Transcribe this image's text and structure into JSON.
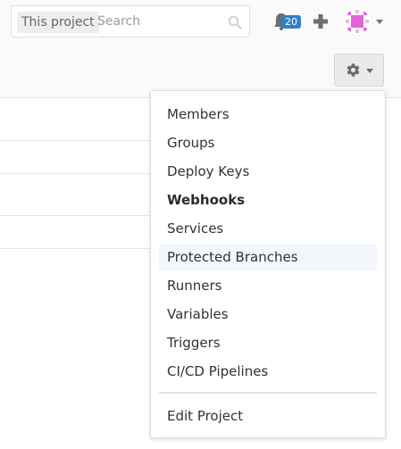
{
  "search": {
    "scope_label": "This project",
    "placeholder": "Search"
  },
  "notifications": {
    "count": "20"
  },
  "settings_menu": {
    "items": [
      {
        "label": "Members"
      },
      {
        "label": "Groups"
      },
      {
        "label": "Deploy Keys"
      },
      {
        "label": "Webhooks"
      },
      {
        "label": "Services"
      },
      {
        "label": "Protected Branches"
      },
      {
        "label": "Runners"
      },
      {
        "label": "Variables"
      },
      {
        "label": "Triggers"
      },
      {
        "label": "CI/CD Pipelines"
      }
    ],
    "footer_item": {
      "label": "Edit Project"
    },
    "active_item": "Webhooks",
    "hovered_item": "Protected Branches"
  },
  "icons": {
    "search": "search-icon",
    "notifications": "bell-icon",
    "new": "plus-icon",
    "avatar": "identicon-avatar",
    "settings": "gear-icon"
  },
  "colors": {
    "badge": "#2f80c9",
    "avatar_accent": "#e066d6",
    "hover_bg": "#f3f7fc"
  }
}
